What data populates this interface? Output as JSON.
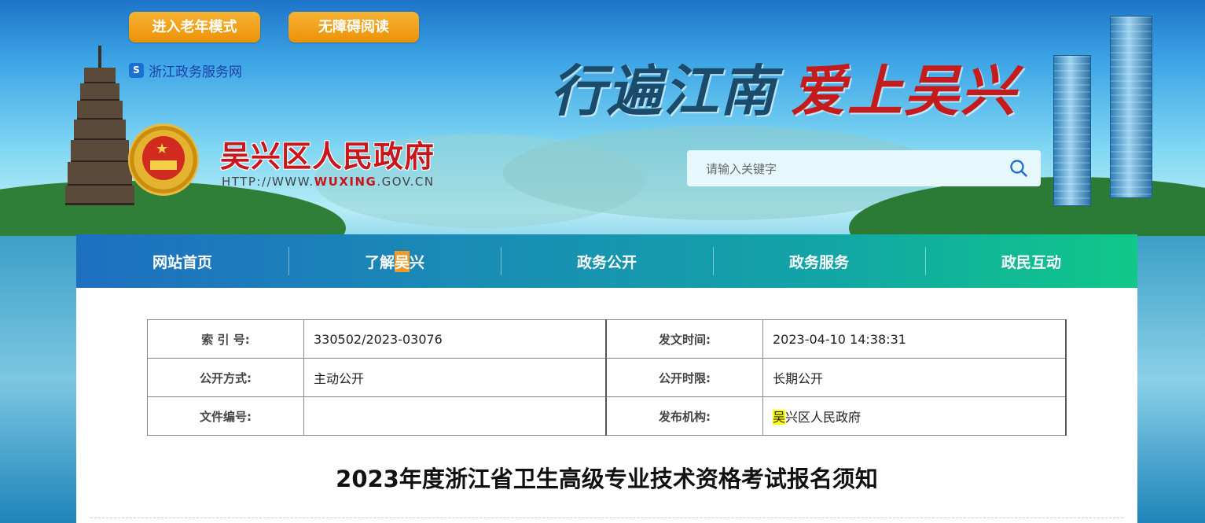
{
  "top_buttons": {
    "elder_mode": "进入老年模式",
    "accessible_reading": "无障碍阅读"
  },
  "portal_link": {
    "icon": "zhejiang-portal-icon",
    "label": "浙江政务服务网"
  },
  "site": {
    "name": "吴兴区人民政府",
    "url_prefix": "HTTP://WWW.",
    "url_domain": "WUXING",
    "url_suffix": ".GOV.CN"
  },
  "slogan": {
    "part1": "行遍江南",
    "part2": "爱上吴兴"
  },
  "search": {
    "placeholder": "请输入关键字",
    "icon": "search-icon"
  },
  "nav": [
    {
      "label": "网站首页"
    },
    {
      "label_pre": "了解",
      "label_hl": "吴",
      "label_post": "兴"
    },
    {
      "label": "政务公开"
    },
    {
      "label": "政务服务"
    },
    {
      "label": "政民互动"
    }
  ],
  "meta": {
    "index_label": "索 引 号:",
    "index_value": "330502/2023-03076",
    "date_label": "发文时间:",
    "date_value": "2023-04-10 14:38:31",
    "open_method_label": "公开方式:",
    "open_method_value": "主动公开",
    "open_period_label": "公开时限:",
    "open_period_value": "长期公开",
    "doc_no_label": "文件编号:",
    "doc_no_value": "",
    "publisher_label": "发布机构:",
    "publisher_hl": "吴",
    "publisher_rest": "兴区人民政府"
  },
  "article": {
    "title": "2023年度浙江省卫生高级专业技术资格考试报名须知"
  },
  "colors": {
    "nav_start": "#1e6fc0",
    "nav_end": "#10c889",
    "button_orange": "#ec9206",
    "site_red": "#c8161d"
  }
}
